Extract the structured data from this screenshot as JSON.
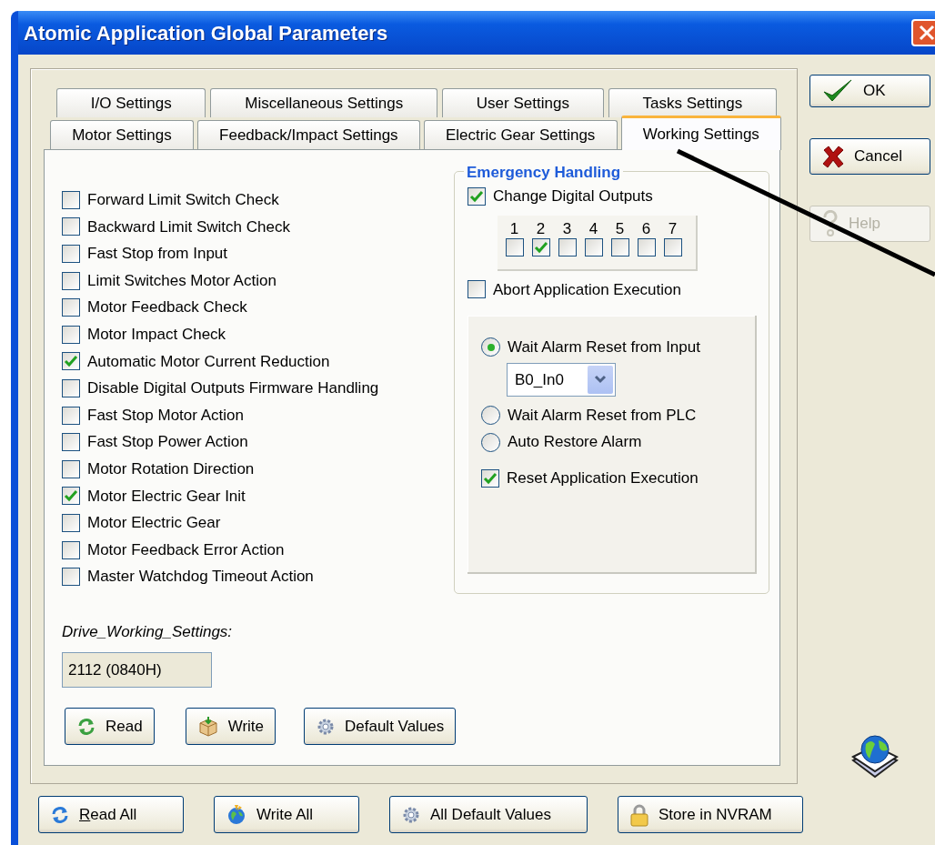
{
  "window": {
    "title": "Atomic Application Global Parameters"
  },
  "tab_rows": [
    {
      "tabs": [
        {
          "label": "I/O Settings",
          "selected": false
        },
        {
          "label": "Miscellaneous Settings",
          "selected": false
        },
        {
          "label": "User Settings",
          "selected": false
        },
        {
          "label": "Tasks Settings",
          "selected": false
        }
      ]
    },
    {
      "tabs": [
        {
          "label": "Motor Settings",
          "selected": false
        },
        {
          "label": "Feedback/Impact Settings",
          "selected": false
        },
        {
          "label": "Electric Gear Settings",
          "selected": false
        },
        {
          "label": "Working Settings",
          "selected": true
        }
      ]
    }
  ],
  "options": [
    {
      "label": "Forward Limit Switch Check",
      "checked": false
    },
    {
      "label": "Backward Limit Switch Check",
      "checked": false
    },
    {
      "label": "Fast Stop from Input",
      "checked": false
    },
    {
      "label": "Limit Switches Motor Action",
      "checked": false
    },
    {
      "label": "Motor Feedback Check",
      "checked": false
    },
    {
      "label": "Motor Impact Check",
      "checked": false
    },
    {
      "label": "Automatic Motor Current Reduction",
      "checked": true
    },
    {
      "label": "Disable Digital Outputs Firmware Handling",
      "checked": false
    },
    {
      "label": "Fast Stop Motor Action",
      "checked": false
    },
    {
      "label": "Fast Stop Power Action",
      "checked": false
    },
    {
      "label": "Motor Rotation Direction",
      "checked": false
    },
    {
      "label": "Motor Electric Gear Init",
      "checked": true
    },
    {
      "label": "Motor Electric Gear",
      "checked": false
    },
    {
      "label": "Motor Feedback Error Action",
      "checked": false
    },
    {
      "label": "Master Watchdog Timeout Action",
      "checked": false
    }
  ],
  "emergency": {
    "title": "Emergency Handling",
    "change_outputs": {
      "label": "Change Digital Outputs",
      "checked": true
    },
    "outputs": [
      {
        "label": "1",
        "checked": false
      },
      {
        "label": "2",
        "checked": true
      },
      {
        "label": "3",
        "checked": false
      },
      {
        "label": "4",
        "checked": false
      },
      {
        "label": "5",
        "checked": false
      },
      {
        "label": "6",
        "checked": false
      },
      {
        "label": "7",
        "checked": false
      }
    ],
    "abort": {
      "label": "Abort Application Execution",
      "checked": false
    },
    "alarm_modes": [
      {
        "label": "Wait Alarm Reset from Input",
        "selected": true,
        "select": {
          "value": "B0_In0"
        }
      },
      {
        "label": "Wait Alarm Reset from PLC",
        "selected": false
      },
      {
        "label": "Auto Restore Alarm",
        "selected": false
      }
    ],
    "reset": {
      "label": "Reset Application Execution",
      "checked": true
    }
  },
  "drive": {
    "label": "Drive_Working_Settings:",
    "value": "2112 (0840H)"
  },
  "panel_buttons": [
    {
      "label": "Read"
    },
    {
      "label": "Write"
    },
    {
      "label": "Default Values"
    }
  ],
  "dialog_buttons": [
    {
      "label": "OK",
      "disabled": false
    },
    {
      "label": "Cancel",
      "disabled": false
    },
    {
      "label": "Help",
      "disabled": true
    }
  ],
  "bottom_buttons": [
    {
      "label": "Read All",
      "mnemonic": true
    },
    {
      "label": "Write All",
      "mnemonic": false
    },
    {
      "label": "All Default Values",
      "mnemonic": false
    },
    {
      "label": "Store in NVRAM",
      "mnemonic": false
    }
  ]
}
